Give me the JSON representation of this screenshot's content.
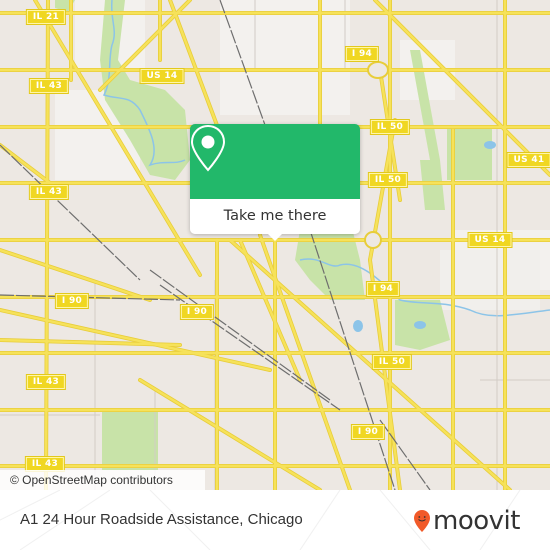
{
  "map": {
    "city": "Chicago",
    "colors": {
      "land": "#ede8e3",
      "road": "#f6e25a",
      "road_outline": "#e8cd3a",
      "park": "#c8e3a8",
      "water": "#8cc4e8",
      "rail": "#6e6e6e",
      "shield": "#f0d722"
    },
    "route_shields": [
      {
        "label": "IL 21"
      },
      {
        "label": "US 14"
      },
      {
        "label": "I 94"
      },
      {
        "label": "IL 43"
      },
      {
        "label": "IL 50"
      },
      {
        "label": "US 41"
      },
      {
        "label": "IL 50"
      },
      {
        "label": "US 14"
      },
      {
        "label": "I 94"
      },
      {
        "label": "I 90"
      },
      {
        "label": "I 90"
      },
      {
        "label": "IL 43"
      },
      {
        "label": "IL 50"
      },
      {
        "label": "I 90"
      },
      {
        "label": "IL 43"
      }
    ],
    "attribution": "© OpenStreetMap contributors"
  },
  "popup": {
    "button_label": "Take me there",
    "icon": "map-pin-icon",
    "accent_color": "#22b86a"
  },
  "footer": {
    "place_name": "A1 24 Hour Roadside Assistance, Chicago",
    "brand": "moovit",
    "brand_color": "#f15a29"
  }
}
